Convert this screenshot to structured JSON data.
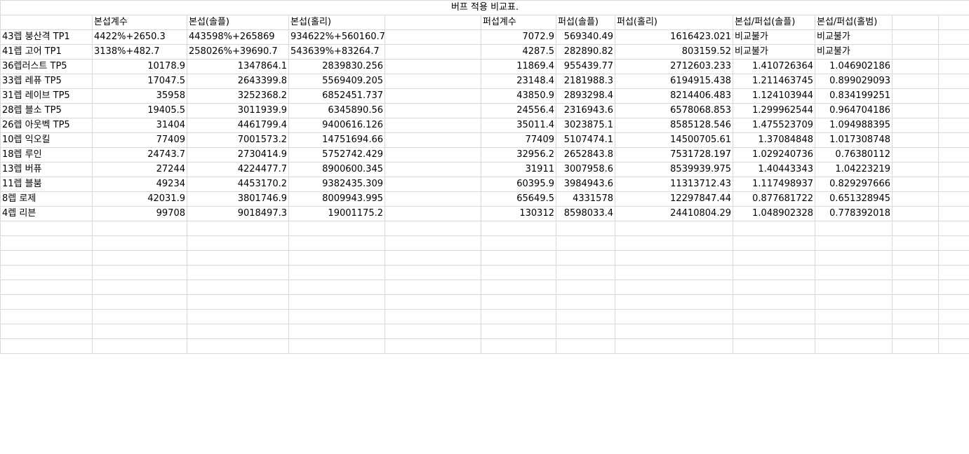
{
  "title": "버프 적용 비교표.",
  "headers": [
    "",
    "본섭계수",
    "본섭(솔플)",
    "본섭(홀리)",
    "",
    "퍼섭계수",
    "퍼섭(솔플)",
    "퍼섭(홀리)",
    "본섭/퍼섭(솔플)",
    "본섭/퍼섭(홀범)",
    "",
    ""
  ],
  "rows": [
    [
      "43렙 붕산격 TP1",
      "4422%+2650.3",
      "443598%+265869",
      "934622%+560160.7",
      "",
      "7072.9",
      "569340.49",
      "1616423.021",
      "비교불가",
      "비교불가",
      "",
      ""
    ],
    [
      "41렙 고어 TP1",
      "3138%+482.7",
      "258026%+39690.7",
      "543639%+83264.7",
      "",
      "4287.5",
      "282890.82",
      "803159.52",
      "비교불가",
      "비교불가",
      "",
      ""
    ],
    [
      "36렙러스트 TP5",
      "10178.9",
      "1347864.1",
      "2839830.256",
      "",
      "11869.4",
      "955439.77",
      "2712603.233",
      "1.410726364",
      "1.046902186",
      "",
      ""
    ],
    [
      "33렙 레퓨 TP5",
      "17047.5",
      "2643399.8",
      "5569409.205",
      "",
      "23148.4",
      "2181988.3",
      "6194915.438",
      "1.211463745",
      "0.899029093",
      "",
      ""
    ],
    [
      "31렙 레이브 TP5",
      "35958",
      "3252368.2",
      "6852451.737",
      "",
      "43850.9",
      "2893298.4",
      "8214406.483",
      "1.124103944",
      "0.834199251",
      "",
      ""
    ],
    [
      "28렙 블소 TP5",
      "19405.5",
      "3011939.9",
      "6345890.56",
      "",
      "24556.4",
      "2316943.6",
      "6578068.853",
      "1.299962544",
      "0.964704186",
      "",
      ""
    ],
    [
      "26렙 아웃벡 TP5",
      "31404",
      "4461799.4",
      "9400616.126",
      "",
      "35011.4",
      "3023875.1",
      "8585128.546",
      "1.475523709",
      "1.094988395",
      "",
      ""
    ],
    [
      "10렙 익오킬",
      "77409",
      "7001573.2",
      "14751694.66",
      "",
      "77409",
      "5107474.1",
      "14500705.61",
      "1.37084848",
      "1.017308748",
      "",
      ""
    ],
    [
      "18렙 루인",
      "24743.7",
      "2730414.9",
      "5752742.429",
      "",
      "32956.2",
      "2652843.8",
      "7531728.197",
      "1.029240736",
      "0.76380112",
      "",
      ""
    ],
    [
      "13렙 버퓨",
      "27244",
      "4224477.7",
      "8900600.345",
      "",
      "31911",
      "3007958.6",
      "8539939.975",
      "1.40443343",
      "1.04223219",
      "",
      ""
    ],
    [
      "11렙 블붐",
      "49234",
      "4453170.2",
      "9382435.309",
      "",
      "60395.9",
      "3984943.6",
      "11313712.43",
      "1.117498937",
      "0.829297666",
      "",
      ""
    ],
    [
      "8렙 로제",
      "42031.9",
      "3801746.9",
      "8009943.995",
      "",
      "65649.5",
      "4331578",
      "12297847.44",
      "0.877681722",
      "0.651328945",
      "",
      ""
    ],
    [
      "4렙 리븐",
      "99708",
      "9018497.3",
      "19001175.2",
      "",
      "130312",
      "8598033.4",
      "24410804.29",
      "1.048902328",
      "0.778392018",
      "",
      ""
    ]
  ],
  "empty_rows": 9
}
